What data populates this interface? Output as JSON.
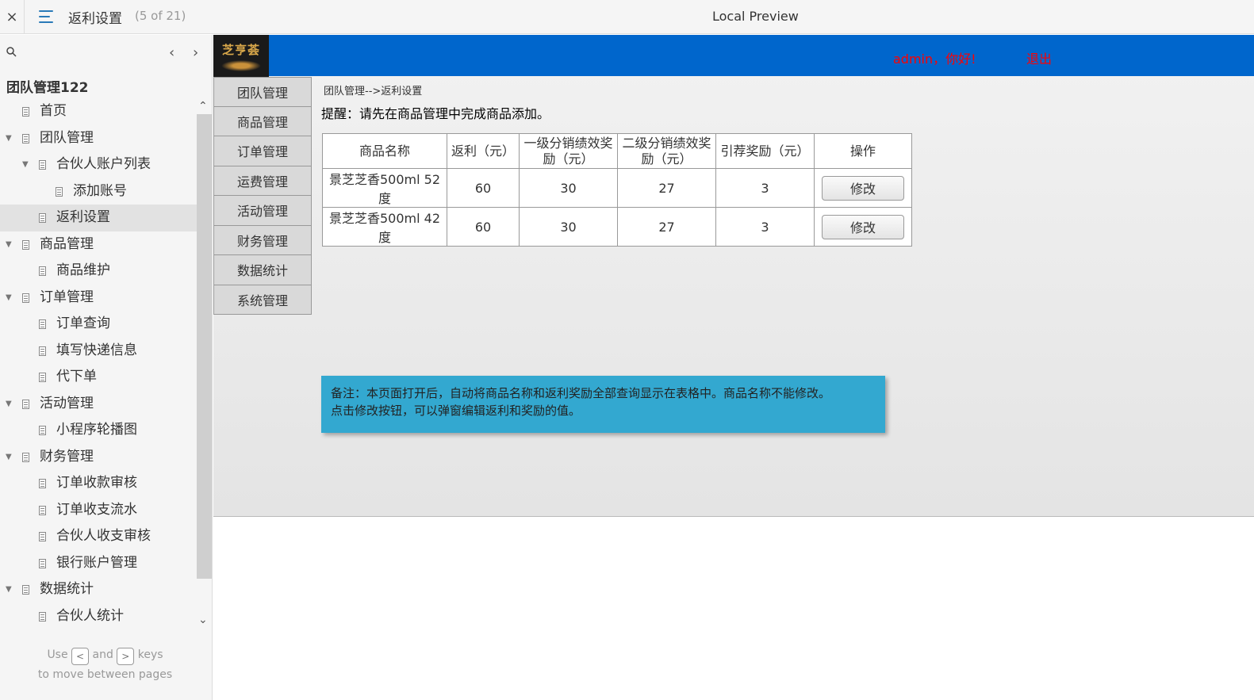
{
  "topbar": {
    "close_icon": "×",
    "page_title": "返利设置",
    "page_count": "(5 of 21)",
    "preview_title": "Local Preview"
  },
  "sidebar": {
    "project_title": "团队管理122",
    "tree": [
      {
        "label": "首页",
        "level": 0,
        "expandable": false
      },
      {
        "label": "团队管理",
        "level": 0,
        "expandable": true
      },
      {
        "label": "合伙人账户列表",
        "level": 1,
        "expandable": true
      },
      {
        "label": "添加账号",
        "level": 2,
        "expandable": false
      },
      {
        "label": "返利设置",
        "level": 1,
        "expandable": false,
        "selected": true
      },
      {
        "label": "商品管理",
        "level": 0,
        "expandable": true
      },
      {
        "label": "商品维护",
        "level": 1,
        "expandable": false
      },
      {
        "label": "订单管理",
        "level": 0,
        "expandable": true
      },
      {
        "label": "订单查询",
        "level": 1,
        "expandable": false
      },
      {
        "label": "填写快递信息",
        "level": 1,
        "expandable": false
      },
      {
        "label": "代下单",
        "level": 1,
        "expandable": false
      },
      {
        "label": "活动管理",
        "level": 0,
        "expandable": true
      },
      {
        "label": "小程序轮播图",
        "level": 1,
        "expandable": false
      },
      {
        "label": "财务管理",
        "level": 0,
        "expandable": true
      },
      {
        "label": "订单收款审核",
        "level": 1,
        "expandable": false
      },
      {
        "label": "订单收支流水",
        "level": 1,
        "expandable": false
      },
      {
        "label": "合伙人收支审核",
        "level": 1,
        "expandable": false
      },
      {
        "label": "银行账户管理",
        "level": 1,
        "expandable": false
      },
      {
        "label": "数据统计",
        "level": 0,
        "expandable": true
      },
      {
        "label": "合伙人统计",
        "level": 1,
        "expandable": false
      }
    ],
    "hint": {
      "use": "Use",
      "and": "and",
      "keys": "keys",
      "line2": "to move between pages",
      "key1": "<",
      "key2": ">"
    }
  },
  "app": {
    "logo_text": "芝亨荟",
    "greeting": "admin，你好!",
    "logout": "退出",
    "nav": [
      "团队管理",
      "商品管理",
      "订单管理",
      "运费管理",
      "活动管理",
      "财务管理",
      "数据统计",
      "系统管理"
    ],
    "breadcrumb": "团队管理-->返利设置",
    "reminder": "提醒：请先在商品管理中完成商品添加。",
    "table": {
      "headers": [
        "商品名称",
        "返利（元）",
        "一级分销绩效奖励（元）",
        "二级分销绩效奖励（元）",
        "引荐奖励（元）",
        "操作"
      ],
      "rows": [
        {
          "name": "景芝芝香500ml 52度",
          "rebate": "60",
          "level1": "30",
          "level2": "27",
          "referral": "3",
          "action": "修改"
        },
        {
          "name": "景芝芝香500ml 42度",
          "rebate": "60",
          "level1": "30",
          "level2": "27",
          "referral": "3",
          "action": "修改"
        }
      ]
    },
    "note_line1": "备注：本页面打开后，自动将商品名称和返利奖励全部查询显示在表格中。商品名称不能修改。",
    "note_line2": "点击修改按钮，可以弹窗编辑返利和奖励的值。"
  },
  "colors": {
    "header_blue": "#0066cc",
    "alert_red": "#ff0000",
    "note_bg": "#33a8d0"
  }
}
